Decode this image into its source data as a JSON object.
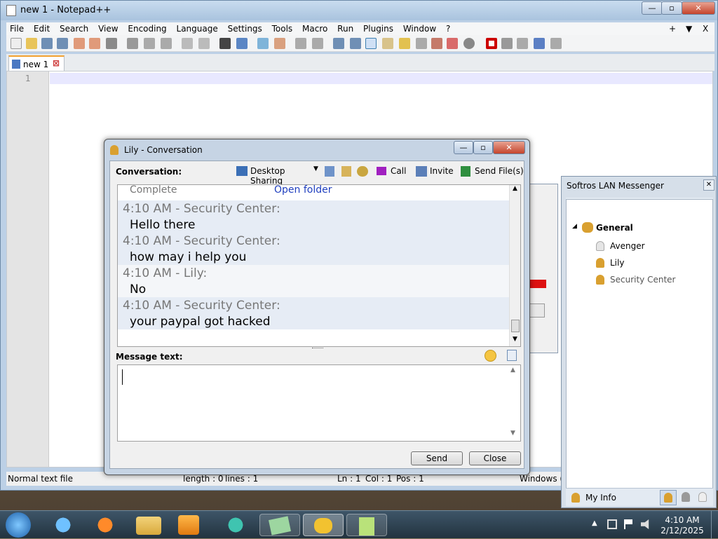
{
  "notepad": {
    "title": "new 1 - Notepad++",
    "menu": [
      "File",
      "Edit",
      "Search",
      "View",
      "Encoding",
      "Language",
      "Settings",
      "Tools",
      "Macro",
      "Run",
      "Plugins",
      "Window",
      "?"
    ],
    "menu_right": [
      "+",
      "▼",
      "X"
    ],
    "tab_label": "new 1",
    "line_number": "1",
    "status": {
      "file_type": "Normal text file",
      "length": "length : 0",
      "lines": "lines : 1",
      "ln": "Ln : 1",
      "col": "Col : 1",
      "pos": "Pos : 1",
      "eol": "Windows (C"
    }
  },
  "conversation": {
    "title": "Lily - Conversation",
    "label": "Conversation:",
    "toolbar": {
      "desktop_sharing": "Desktop Sharing",
      "call": "Call",
      "invite": "Invite",
      "send_files": "Send File(s)"
    },
    "transfer": {
      "status": "Complete",
      "link": "Open folder"
    },
    "messages": [
      {
        "header": "4:10 AM - Security Center:",
        "text": "Hello there"
      },
      {
        "header": "4:10 AM - Security Center:",
        "text": "how may i help you"
      },
      {
        "header": "4:10 AM - Lily:",
        "text": "No"
      },
      {
        "header": "4:10 AM - Security Center:",
        "text": "your paypal got hacked"
      }
    ],
    "message_label": "Message text:",
    "send_label": "Send",
    "close_label": "Close"
  },
  "messenger": {
    "title": "Softros LAN Messenger",
    "group": "General",
    "contacts": [
      {
        "name": "Avenger",
        "status": "offline"
      },
      {
        "name": "Lily",
        "status": "online"
      },
      {
        "name": "Security Center",
        "status": "online"
      }
    ],
    "my_info": "My Info"
  },
  "taskbar": {
    "time": "4:10 AM",
    "date": "2/12/2025"
  },
  "colors": {
    "accent": "#f2a12f",
    "chat_alt_bg": "#e6ecf5",
    "link": "#1f3fbf"
  }
}
